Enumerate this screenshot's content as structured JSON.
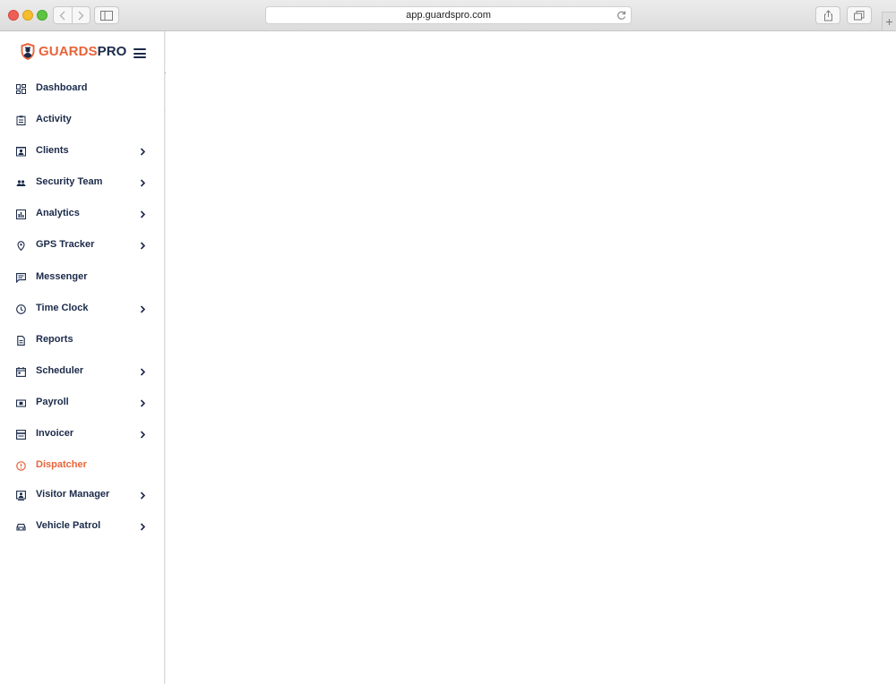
{
  "browser": {
    "url": "app.guardspro.com",
    "icons": [
      "back-arrow-icon",
      "forward-arrow-icon",
      "sidebar-icon",
      "reload-icon",
      "share-icon",
      "tabs-icon",
      "plus-icon"
    ]
  },
  "brand": {
    "part1": "GUARDS",
    "part2": "PRO",
    "accent_color": "#e8643a",
    "text_color": "#1b2a4a"
  },
  "sidebar": {
    "items": [
      {
        "label": "Dashboard",
        "icon": "dashboard-icon",
        "has_submenu": false,
        "active": false
      },
      {
        "label": "Activity",
        "icon": "clipboard-icon",
        "has_submenu": false,
        "active": false
      },
      {
        "label": "Clients",
        "icon": "contact-card-icon",
        "has_submenu": true,
        "active": false
      },
      {
        "label": "Security Team",
        "icon": "people-icon",
        "has_submenu": true,
        "active": false
      },
      {
        "label": "Analytics",
        "icon": "bar-chart-icon",
        "has_submenu": true,
        "active": false
      },
      {
        "label": "GPS Tracker",
        "icon": "map-pin-icon",
        "has_submenu": true,
        "active": false
      },
      {
        "label": "Messenger",
        "icon": "chat-icon",
        "has_submenu": false,
        "active": false
      },
      {
        "label": "Time Clock",
        "icon": "clock-icon",
        "has_submenu": true,
        "active": false
      },
      {
        "label": "Reports",
        "icon": "document-icon",
        "has_submenu": false,
        "active": false
      },
      {
        "label": "Scheduler",
        "icon": "calendar-icon",
        "has_submenu": true,
        "active": false
      },
      {
        "label": "Payroll",
        "icon": "money-icon",
        "has_submenu": true,
        "active": false
      },
      {
        "label": "Invoicer",
        "icon": "invoice-icon",
        "has_submenu": true,
        "active": false
      },
      {
        "label": "Dispatcher",
        "icon": "alert-icon",
        "has_submenu": false,
        "active": true
      },
      {
        "label": "Visitor Manager",
        "icon": "visitor-icon",
        "has_submenu": true,
        "active": false
      },
      {
        "label": "Vehicle Patrol",
        "icon": "car-icon",
        "has_submenu": true,
        "active": false
      }
    ]
  }
}
